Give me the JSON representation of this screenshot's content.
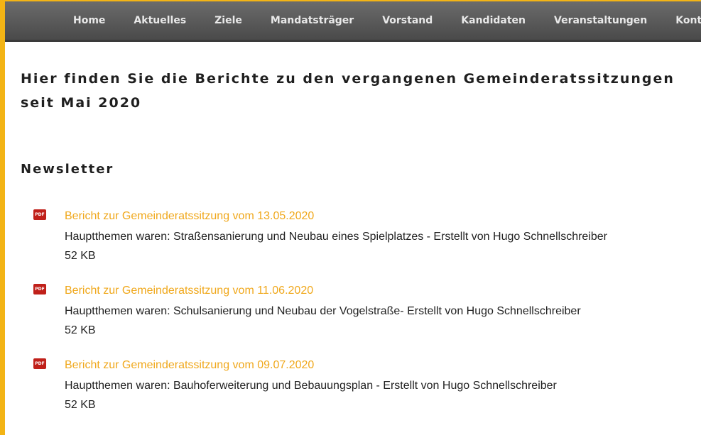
{
  "nav": {
    "items": [
      {
        "label": "Home"
      },
      {
        "label": "Aktuelles"
      },
      {
        "label": "Ziele"
      },
      {
        "label": "Mandatsträger"
      },
      {
        "label": "Vorstand"
      },
      {
        "label": "Kandidaten"
      },
      {
        "label": "Veranstaltungen"
      },
      {
        "label": "Kontak"
      }
    ]
  },
  "page": {
    "headline": "Hier finden Sie die Berichte zu den vergangenen Gemeinderatssitzungen seit Mai 2020",
    "section_title": "Newsletter"
  },
  "documents": [
    {
      "icon": "pdf-icon",
      "icon_label": "PDF",
      "title": "Bericht zur Gemeinderatssitzung vom 13.05.2020",
      "description": "Hauptthemen waren: Straßensanierung und Neubau eines Spielplatzes - Erstellt von Hugo Schnellschreiber",
      "size": "52 KB"
    },
    {
      "icon": "pdf-icon",
      "icon_label": "PDF",
      "title": "Bericht zur Gemeinderatssitzung vom 11.06.2020",
      "description": "Hauptthemen waren: Schulsanierung und Neubau der Vogelstraße- Erstellt von Hugo Schnellschreiber",
      "size": "52 KB"
    },
    {
      "icon": "pdf-icon",
      "icon_label": "PDF",
      "title": "Bericht zur Gemeinderatssitzung vom 09.07.2020",
      "description": "Hauptthemen waren: Bauhoferweiterung und Bebauungsplan - Erstellt von Hugo Schnellschreiber",
      "size": "52 KB"
    }
  ],
  "colors": {
    "frame_accent": "#f3b415",
    "link": "#f0a81c",
    "navbar": "#555555",
    "pdf_icon": "#c0201a"
  }
}
